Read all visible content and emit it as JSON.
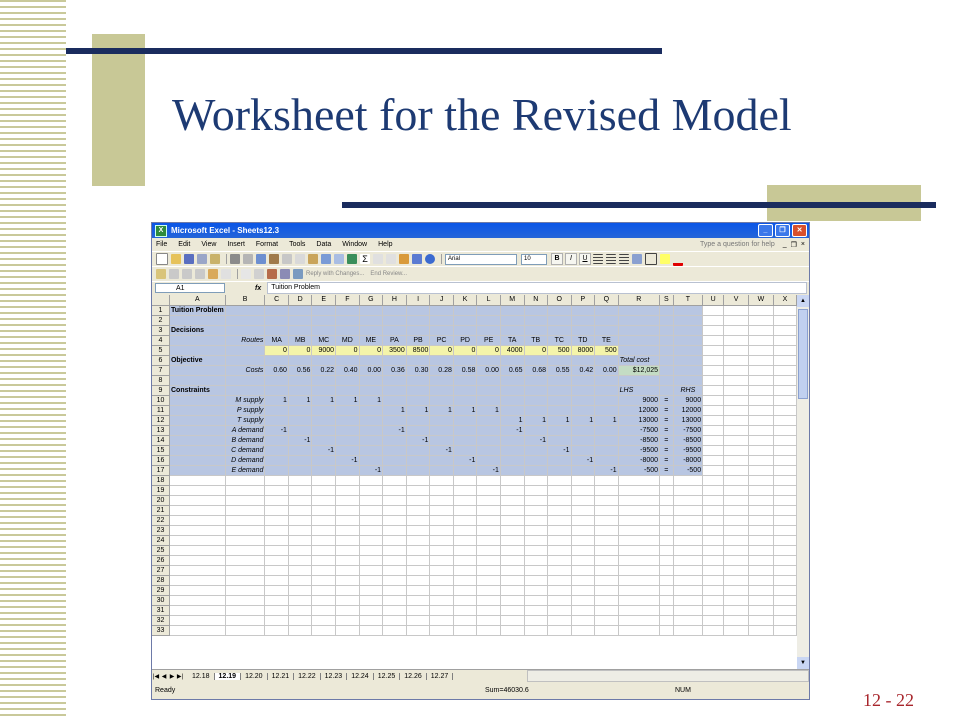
{
  "slide": {
    "title": "Worksheet for the Revised Model",
    "page_number": "12 - 22"
  },
  "excel": {
    "window_title": "Microsoft Excel - Sheets12.3",
    "menu": [
      "File",
      "Edit",
      "View",
      "Insert",
      "Format",
      "Tools",
      "Data",
      "Window",
      "Help"
    ],
    "help_placeholder": "Type a question for help",
    "font_name": "Arial",
    "font_size": "10",
    "reply_with_changes": "Reply with Changes...",
    "end_review": "End Review...",
    "name_box": "A1",
    "fx": "fx",
    "formula": "Tuition Problem",
    "columns": [
      "A",
      "B",
      "C",
      "D",
      "E",
      "F",
      "G",
      "H",
      "I",
      "J",
      "K",
      "L",
      "M",
      "N",
      "O",
      "P",
      "Q",
      "R",
      "S",
      "T",
      "U",
      "V",
      "W",
      "X"
    ],
    "rows": [
      {
        "n": "1",
        "cells": {
          "A": "Tuition Problem"
        }
      },
      {
        "n": "2",
        "cells": {}
      },
      {
        "n": "3",
        "cells": {
          "A": "Decisions"
        }
      },
      {
        "n": "4",
        "cells": {
          "B": "Routes",
          "C": "MA",
          "D": "MB",
          "E": "MC",
          "F": "MD",
          "G": "ME",
          "H": "PA",
          "I": "PB",
          "J": "PC",
          "K": "PD",
          "L": "PE",
          "M": "TA",
          "N": "TB",
          "O": "TC",
          "P": "TD",
          "Q": "TE"
        }
      },
      {
        "n": "5",
        "cells": {
          "C": "0",
          "D": "0",
          "E": "9000",
          "F": "0",
          "G": "0",
          "H": "3500",
          "I": "8500",
          "J": "0",
          "K": "0",
          "L": "0",
          "M": "4000",
          "N": "0",
          "O": "500",
          "P": "8000",
          "Q": "500"
        }
      },
      {
        "n": "6",
        "cells": {
          "A": "Objective",
          "R": "Total cost"
        }
      },
      {
        "n": "7",
        "cells": {
          "B": "Costs",
          "C": "0.60",
          "D": "0.56",
          "E": "0.22",
          "F": "0.40",
          "G": "0.00",
          "H": "0.36",
          "I": "0.30",
          "J": "0.28",
          "K": "0.58",
          "L": "0.00",
          "M": "0.65",
          "N": "0.68",
          "O": "0.55",
          "P": "0.42",
          "Q": "0.00",
          "R": "$12,025"
        }
      },
      {
        "n": "8",
        "cells": {}
      },
      {
        "n": "9",
        "cells": {
          "A": "Constraints",
          "R": "LHS",
          "T": "RHS"
        }
      },
      {
        "n": "10",
        "cells": {
          "B": "M supply",
          "C": "1",
          "D": "1",
          "E": "1",
          "F": "1",
          "G": "1",
          "R": "9000",
          "S": "=",
          "T": "9000"
        }
      },
      {
        "n": "11",
        "cells": {
          "B": "P supply",
          "H": "1",
          "I": "1",
          "J": "1",
          "K": "1",
          "L": "1",
          "R": "12000",
          "S": "=",
          "T": "12000"
        }
      },
      {
        "n": "12",
        "cells": {
          "B": "T supply",
          "M": "1",
          "N": "1",
          "O": "1",
          "P": "1",
          "Q": "1",
          "R": "13000",
          "S": "=",
          "T": "13000"
        }
      },
      {
        "n": "13",
        "cells": {
          "B": "A demand",
          "C": "-1",
          "H": "-1",
          "M": "-1",
          "R": "-7500",
          "S": "=",
          "T": "-7500"
        }
      },
      {
        "n": "14",
        "cells": {
          "B": "B demand",
          "D": "-1",
          "I": "-1",
          "N": "-1",
          "R": "-8500",
          "S": "=",
          "T": "-8500"
        }
      },
      {
        "n": "15",
        "cells": {
          "B": "C demand",
          "E": "-1",
          "J": "-1",
          "O": "-1",
          "R": "-9500",
          "S": "=",
          "T": "-9500"
        }
      },
      {
        "n": "16",
        "cells": {
          "B": "D demand",
          "F": "-1",
          "K": "-1",
          "P": "-1",
          "R": "-8000",
          "S": "=",
          "T": "-8000"
        }
      },
      {
        "n": "17",
        "cells": {
          "B": "E demand",
          "G": "-1",
          "L": "-1",
          "Q": "-1",
          "R": "-500",
          "S": "=",
          "T": "-500"
        }
      },
      {
        "n": "18",
        "cells": {}
      },
      {
        "n": "19",
        "cells": {}
      },
      {
        "n": "20",
        "cells": {}
      },
      {
        "n": "21",
        "cells": {}
      },
      {
        "n": "22",
        "cells": {}
      },
      {
        "n": "23",
        "cells": {}
      },
      {
        "n": "24",
        "cells": {}
      },
      {
        "n": "25",
        "cells": {}
      },
      {
        "n": "26",
        "cells": {}
      },
      {
        "n": "27",
        "cells": {}
      },
      {
        "n": "28",
        "cells": {}
      },
      {
        "n": "29",
        "cells": {}
      },
      {
        "n": "30",
        "cells": {}
      },
      {
        "n": "31",
        "cells": {}
      },
      {
        "n": "32",
        "cells": {}
      },
      {
        "n": "33",
        "cells": {}
      }
    ],
    "sheet_tabs": [
      "12.18",
      "12.19",
      "12.20",
      "12.21",
      "12.22",
      "12.23",
      "12.24",
      "12.25",
      "12.26",
      "12.27"
    ],
    "active_tab": "12.19",
    "status": {
      "ready": "Ready",
      "sum": "Sum=46030.6",
      "num": "NUM"
    }
  }
}
